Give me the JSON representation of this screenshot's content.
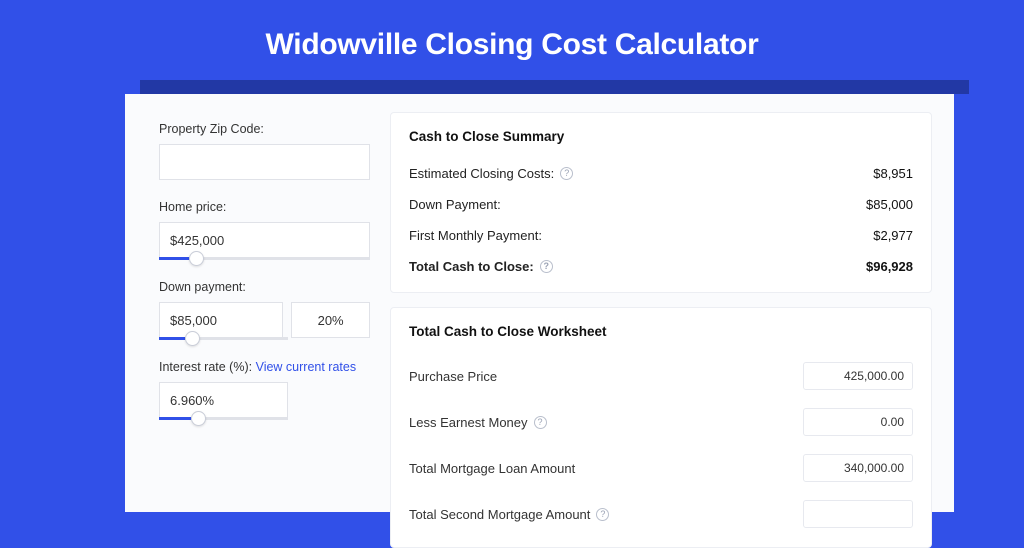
{
  "title": "Widowville Closing Cost Calculator",
  "left": {
    "zip_label": "Property Zip Code:",
    "zip_value": "",
    "home_price_label": "Home price:",
    "home_price_value": "$425,000",
    "home_price_slider_pct": 14,
    "down_payment_label": "Down payment:",
    "down_payment_value": "$85,000",
    "down_payment_pct": "20%",
    "down_payment_slider_pct": 20,
    "interest_label": "Interest rate (%):",
    "interest_link": "View current rates",
    "interest_value": "6.960%",
    "interest_slider_pct": 25
  },
  "summary": {
    "title": "Cash to Close Summary",
    "rows": [
      {
        "label": "Estimated Closing Costs:",
        "help": true,
        "value": "$8,951"
      },
      {
        "label": "Down Payment:",
        "help": false,
        "value": "$85,000"
      },
      {
        "label": "First Monthly Payment:",
        "help": false,
        "value": "$2,977"
      }
    ],
    "total_label": "Total Cash to Close:",
    "total_value": "$96,928"
  },
  "worksheet": {
    "title": "Total Cash to Close Worksheet",
    "rows": [
      {
        "label": "Purchase Price",
        "help": false,
        "value": "425,000.00"
      },
      {
        "label": "Less Earnest Money",
        "help": true,
        "value": "0.00"
      },
      {
        "label": "Total Mortgage Loan Amount",
        "help": false,
        "value": "340,000.00"
      },
      {
        "label": "Total Second Mortgage Amount",
        "help": true,
        "value": ""
      }
    ]
  }
}
